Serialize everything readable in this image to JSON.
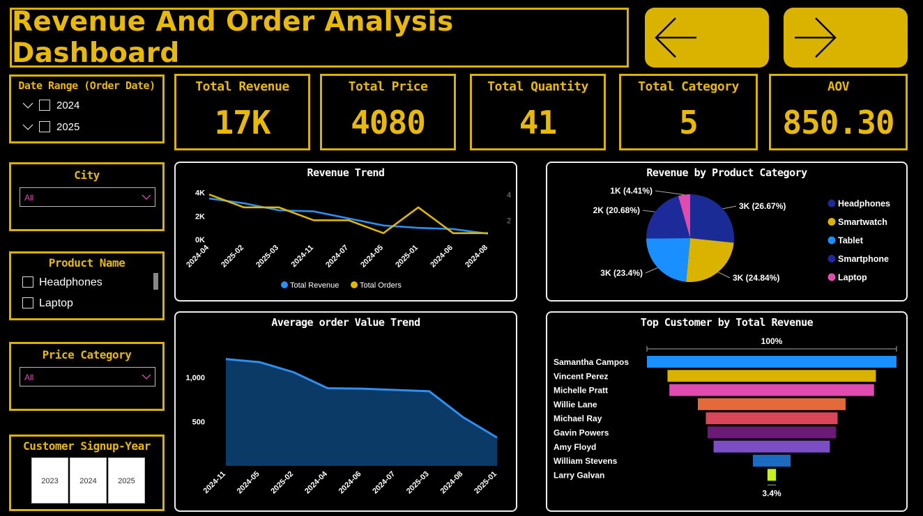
{
  "header": {
    "title": "Revenue And Order Analysis Dashboard"
  },
  "nav": {
    "back_icon": "arrow-left-icon",
    "forward_icon": "arrow-right-icon"
  },
  "kpis": [
    {
      "label": "Total Revenue",
      "value": "17K"
    },
    {
      "label": "Total Price",
      "value": "4080"
    },
    {
      "label": "Total Quantity",
      "value": "41"
    },
    {
      "label": "Total Category",
      "value": "5"
    },
    {
      "label": "AOV",
      "value": "850.30"
    }
  ],
  "filters": {
    "date_range": {
      "title": "Date Range (Order Date)",
      "options": [
        "2024",
        "2025"
      ]
    },
    "city": {
      "title": "City",
      "selected": "All"
    },
    "product_name": {
      "title": "Product Name",
      "options": [
        "Headphones",
        "Laptop"
      ]
    },
    "price_category": {
      "title": "Price Category",
      "selected": "All"
    },
    "signup_year": {
      "title": "Customer Signup-Year",
      "options": [
        "2023",
        "2024",
        "2025"
      ]
    }
  },
  "colors": {
    "accent": "#d9b300",
    "revenue": "#2e8ff0",
    "orders": "#e0b800",
    "area": "#0b3a66"
  },
  "chart_data": [
    {
      "type": "line",
      "title": "Revenue Trend",
      "categories": [
        "2024-04",
        "2025-02",
        "2025-03",
        "2024-11",
        "2024-07",
        "2024-05",
        "2025-01",
        "2024-06",
        "2024-08"
      ],
      "series": [
        {
          "name": "Total Revenue",
          "axis": "left",
          "values": [
            3500,
            3100,
            2500,
            2400,
            1800,
            1200,
            1000,
            900,
            500
          ]
        },
        {
          "name": "Total Orders",
          "axis": "right",
          "values": [
            4,
            3,
            3,
            2,
            2,
            1,
            3,
            1,
            1
          ]
        }
      ],
      "y_left": {
        "ticks": [
          "0K",
          "2K",
          "4K"
        ],
        "lim": [
          0,
          4400
        ]
      },
      "y_right": {
        "ticks": [
          "2",
          "4"
        ],
        "lim": [
          0.5,
          4.5
        ]
      },
      "legend": "bottom-center"
    },
    {
      "type": "pie",
      "title": "Revenue by Product Category",
      "slices": [
        {
          "name": "Headphones",
          "value": 26.67,
          "label": "3K (26.67%)",
          "color": "#1a2b96"
        },
        {
          "name": "Smartwatch",
          "value": 24.84,
          "label": "3K (24.84%)",
          "color": "#d9b300"
        },
        {
          "name": "Tablet",
          "value": 23.4,
          "label": "3K (23.4%)",
          "color": "#1a8fff"
        },
        {
          "name": "Smartphone",
          "value": 20.68,
          "label": "2K (20.68%)",
          "color": "#1c2a9a"
        },
        {
          "name": "Laptop",
          "value": 4.41,
          "label": "1K (4.41%)",
          "color": "#e04bb0"
        }
      ],
      "legend": "right"
    },
    {
      "type": "area",
      "title": "Average order Value Trend",
      "categories": [
        "2024-11",
        "2024-05",
        "2025-02",
        "2024-04",
        "2024-06",
        "2024-07",
        "2025-03",
        "2024-08",
        "2025-01"
      ],
      "values": [
        1210,
        1175,
        1060,
        880,
        875,
        860,
        845,
        550,
        320
      ],
      "y_ticks": [
        "500",
        "1,000"
      ],
      "ylim": [
        0,
        1420
      ]
    },
    {
      "type": "bar",
      "title": "Top Customer by Total Revenue",
      "subtype": "funnel",
      "categories": [
        "Samantha Campos",
        "Vincent Perez",
        "Michelle Pratt",
        "Willie Lane",
        "Michael Ray",
        "Gavin Powers",
        "Amy Floyd",
        "William Stevens",
        "Larry Galvan"
      ],
      "values": [
        100,
        83.5,
        82.0,
        59.2,
        52.8,
        51.4,
        46.6,
        15.1,
        3.4
      ],
      "colors": [
        "#1a8fff",
        "#d9b300",
        "#e04bb0",
        "#e56a3a",
        "#d9465a",
        "#6b1a78",
        "#7b4ec6",
        "#1b6cc0",
        "#c6f21a"
      ],
      "top_label": "100%",
      "bottom_label": "3.4%"
    }
  ]
}
